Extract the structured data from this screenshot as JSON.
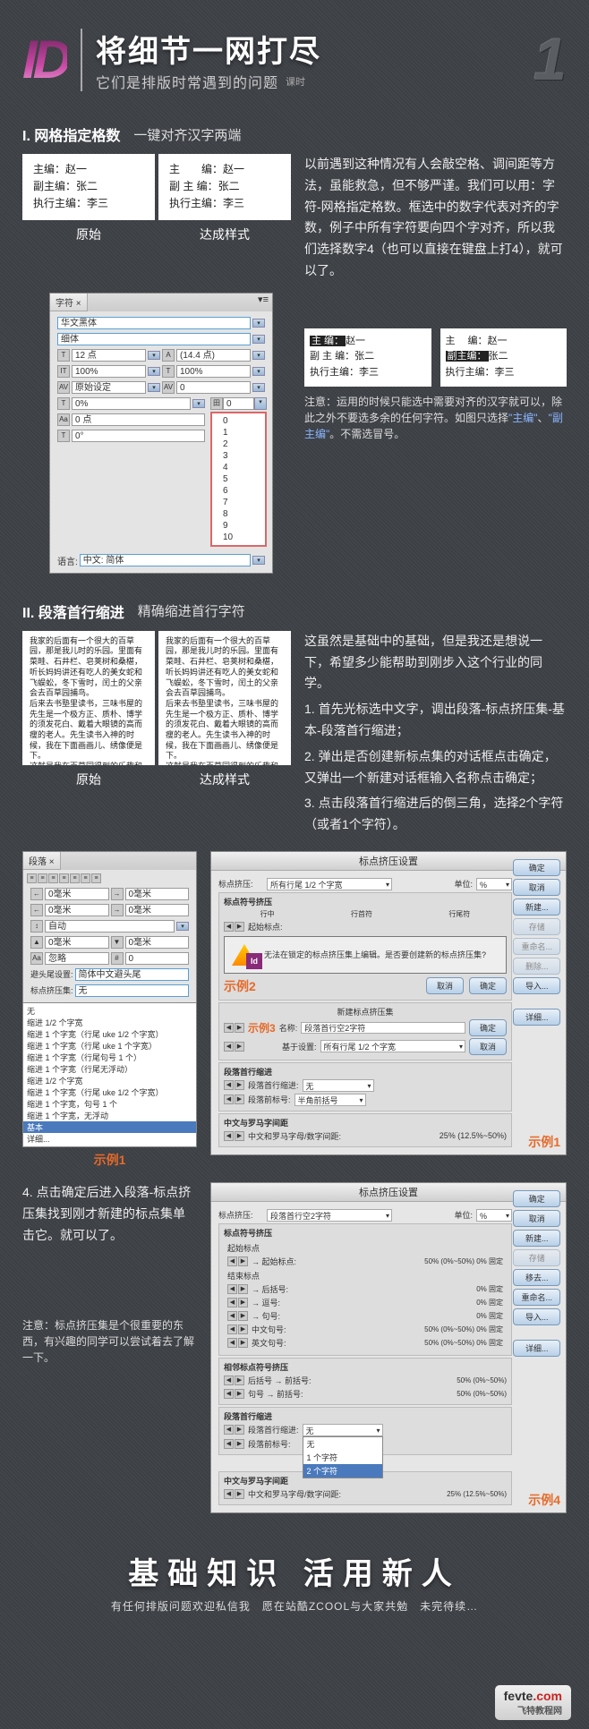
{
  "header": {
    "logo": "ID",
    "title": "将细节一网打尽",
    "subtitle": "它们是排版时常遇到的问题",
    "lesson_label": "课时",
    "lesson_num": "1"
  },
  "section1": {
    "heading": "I. 网格指定格数",
    "sub": "一键对齐汉字两端",
    "original_label": "原始",
    "result_label": "达成样式",
    "sample_original": "主编：赵一\n副主编：张二\n执行主编：李三",
    "sample_result_l1": "主　　编：赵一",
    "sample_result_l2": "副 主 编：张二",
    "sample_result_l3": "执行主编：李三",
    "desc": "以前遇到这种情况有人会敲空格、调间距等方法，虽能救急，但不够严谨。我们可以用：字符-网格指定格数。框选中的数字代表对齐的字数，例子中所有字符要向四个字对齐，所以我们选择数字4（也可以直接在键盘上打4），就可以了。",
    "note": "注意：运用的时候只能选中需要对齐的汉字就可以，除此之外不要选多余的任何字符。如图只选择",
    "note_hl1": "\"主编\"",
    "note_sep": "、",
    "note_hl2": "\"副主编\"",
    "note_tail": "。不需选冒号。",
    "panel": {
      "tab": "字符 ×",
      "font": "华文黑体",
      "weight": "细体",
      "size": "12 点",
      "leading": "(14.4 点)",
      "vscale": "100%",
      "hscale": "100%",
      "baseline": "原始设定",
      "track": "0",
      "kern_label": "0%",
      "shift": "0 点",
      "skew": "0°",
      "lang_label": "语言:",
      "lang": "中文: 简体",
      "dropdown": [
        "0",
        "1",
        "2",
        "3",
        "4",
        "5",
        "6",
        "7",
        "8",
        "9",
        "10"
      ]
    },
    "minibox_a": {
      "l1": "主 编：",
      "l1b": "赵一",
      "l2": "副 主 编：张二",
      "l3": "执行主编：李三"
    },
    "minibox_b": {
      "l1": "主 　编：",
      "l1b": "赵一",
      "l2": "副主编：",
      "l2b": "张二",
      "l3": "执行主编：李三"
    }
  },
  "section2": {
    "heading": "II. 段落首行缩进",
    "sub": "精确缩进首行字符",
    "original_label": "原始",
    "result_label": "达成样式",
    "sample": "我家的后面有一个很大的百草园，那是我儿时的乐园。里面有菜畦、石井栏、皂荚树和桑椹，听长妈妈讲还有吃人的美女蛇和飞蜈蚣，冬下雪时，闰土的父亲会去百草园捕鸟。\n后来去书塾里读书，三味书屋的先生是一个极方正、质朴、博学的须发花白、戴着大眼镜的高而瘦的老人。先生读书入神的时候，我在下面画画儿、绣像便是下。\n这就是我在百草园得到的乐趣和在三味书屋读书的乏味生活……",
    "desc_intro": "这虽然是基础中的基础，但是我还是想说一下，希望多少能帮助到刚步入这个行业的同学。",
    "desc_1": "1. 首先光标选中文字，调出段落-标点挤压集-基本-段落首行缩进；",
    "desc_2": "2. 弹出是否创建新标点集的对话框点击确定，又弹出一个新建对话框输入名称点击确定；",
    "desc_3": "3. 点击段落首行缩进后的倒三角，选择2个字符（或者1个字符）。",
    "step4": "4. 点击确定后进入段落-标点挤压集找到刚才新建的标点集单击它。就可以了。",
    "note2": "注意：标点挤压集是个很重要的东西，有兴趣的同学可以尝试着去了解一下。",
    "ex1_label": "示例1",
    "ex2_label": "示例2",
    "ex3_label": "示例3",
    "ex4_label": "示例4",
    "para_panel": {
      "tab": "段落 ×",
      "basis_label": "避头尾设置:",
      "basis": "简体中文避头尾",
      "moji_label": "标点挤压集:",
      "moji": "无",
      "list": [
        "无",
        "缩进 1/2 个字宽",
        "缩进 1 个字宽（行尾 uke 1/2 个字宽）",
        "缩进 1 个字宽（行尾 uke 1 个字宽）",
        "缩进 1 个字宽（行尾句号 1 个）",
        "缩进 1 个字宽（行尾无浮动）",
        "缩进 1/2 个字宽",
        "缩进 1 个字宽（行尾 uke 1/2 个字宽）",
        "缩进 1 个字宽，句号 1 个",
        "缩进 1 个字宽，无浮动",
        "基本",
        "详细..."
      ]
    },
    "big_dialog": {
      "title": "标点挤压设置",
      "moji_label": "标点挤压:",
      "moji_val": "所有行尾 1/2 个字宽",
      "unit_label": "单位:",
      "unit_val": "%",
      "section_moji": "标点符号挤压",
      "col_mid": "行中",
      "col_start": "行首符",
      "col_end": "行尾符",
      "alert": "无法在锁定的标点挤压集上编辑。是否要创建新的标点挤压集?",
      "alert_cancel": "取消",
      "alert_ok": "确定",
      "new_title": "新建标点挤压集",
      "name_label": "名称:",
      "name_val": "段落首行空2字符",
      "base_label": "基于设置:",
      "base_val": "所有行尾 1/2 个字宽",
      "indent_section": "段落首行缩进",
      "indent_label": "段落首行缩进:",
      "indent_val": "无",
      "indent_before": "段落前标号:",
      "indent_before_val": "半角前括号",
      "roman_section": "中文与罗马字间距",
      "roman_label": "中文和罗马字母/数字间距:",
      "roman_val": "25% (12.5%~50%)",
      "btn_ok": "确定",
      "btn_cancel": "取消",
      "btn_new": "新建...",
      "btn_save": "存储",
      "btn_rename": "重命名...",
      "btn_delete": "删除...",
      "btn_import": "导入...",
      "btn_detail": "详细..."
    },
    "big_dialog2": {
      "title": "标点挤压设置",
      "moji_val": "段落首行空2字符",
      "start_section": "起始标点",
      "start_row": "→ 起始标点:",
      "start_vals": "50% (0%~50%)    0% 固定",
      "end_section": "结束标点",
      "end_rows": [
        {
          "l": "→ 后括号:",
          "v": "0% 固定"
        },
        {
          "l": "→ 逗号:",
          "v": "0% 固定"
        },
        {
          "l": "→ 句号:",
          "v": "0% 固定"
        },
        {
          "l": "中文句号:",
          "v": "50% (0%~50%)    0% 固定"
        },
        {
          "l": "英文句号:",
          "v": "50% (0%~50%)    0% 固定"
        }
      ],
      "adj_section": "相邻标点符号挤压",
      "adj_rows": [
        {
          "l": "后括号 → 前括号:",
          "v": "50% (0%~50%)"
        },
        {
          "l": "句号 → 前括号:",
          "v": "50% (0%~50%)"
        }
      ],
      "indent_section": "段落首行缩进",
      "indent_label": "段落首行缩进:",
      "indent_dropdown": [
        "无",
        "1 个字符",
        "2 个字符"
      ],
      "indent_before": "段落前标号:",
      "roman_section": "中文与罗马字间距",
      "roman_label": "中文和罗马字母/数字间距:",
      "roman_val": "25% (12.5%~50%)",
      "btn_rename": "移去...",
      "btn_rename2": "重命名...",
      "btn_import": "导入..."
    }
  },
  "footer": {
    "main": "基础知识 活用新人",
    "sub": "有任何排版问题欢迎私信我　愿在站酷ZCOOL与大家共勉　未完待续…",
    "brand": "fevte",
    "domain": ".com",
    "brand_sub": "飞特教程网"
  }
}
